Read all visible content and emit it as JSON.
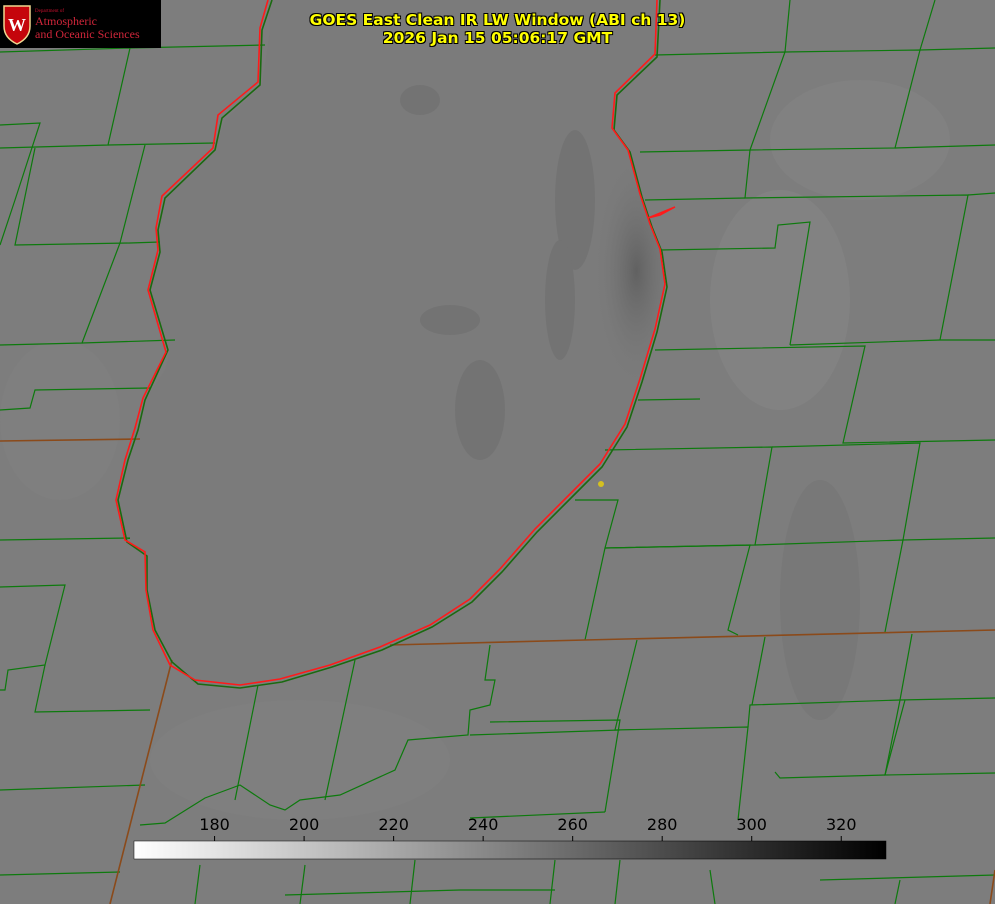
{
  "logo": {
    "department": "Department of",
    "line1": "Atmospheric",
    "line2": "and Oceanic Sciences"
  },
  "title": {
    "line1": "GOES East Clean IR LW Window (ABI ch 13)",
    "line2": "2026 Jan 15 05:06:17 GMT"
  },
  "colorbar": {
    "ticks": [
      "180",
      "200",
      "220",
      "240",
      "260",
      "280",
      "300",
      "320"
    ],
    "min": 162,
    "max": 330
  },
  "colors": {
    "background": "#7c7c7c",
    "county_lines": "#0d7a0d",
    "state_lines": "#a0522d",
    "shoreline": "#ff1a1a",
    "title_text": "#ffff00",
    "marker": "#d4c020"
  }
}
